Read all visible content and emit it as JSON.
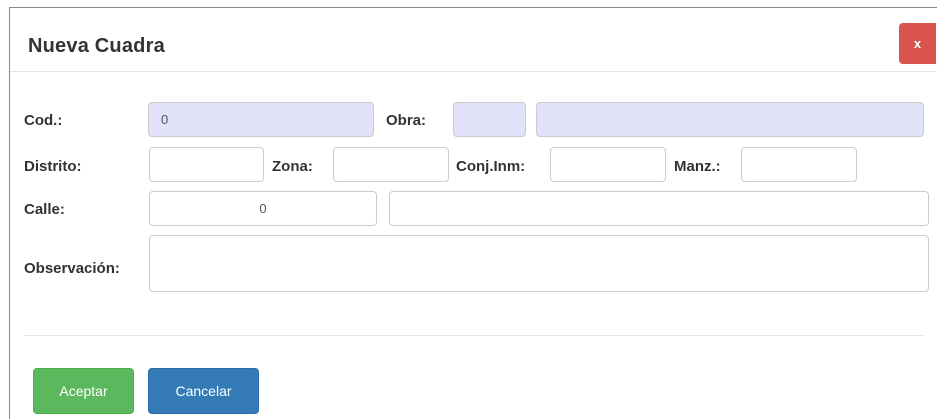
{
  "dialog": {
    "title": "Nueva Cuadra",
    "close_label": "x"
  },
  "form": {
    "cod": {
      "label": "Cod.:",
      "value": "0"
    },
    "obra": {
      "label": "Obra:",
      "code_value": "",
      "name_value": ""
    },
    "distrito": {
      "label": "Distrito:",
      "value": ""
    },
    "zona": {
      "label": "Zona:",
      "value": ""
    },
    "conj_inm": {
      "label": "Conj.Inm:",
      "value": ""
    },
    "manz": {
      "label": "Manz.:",
      "value": ""
    },
    "calle": {
      "label": "Calle:",
      "code_value": "0",
      "name_value": ""
    },
    "observacion": {
      "label": "Observación:",
      "value": ""
    }
  },
  "footer": {
    "accept_label": "Aceptar",
    "cancel_label": "Cancelar"
  },
  "colors": {
    "readonly_bg": "#e1e1f7",
    "accept_green": "#5cb85c",
    "cancel_blue": "#337ab7",
    "close_red": "#d9534f"
  }
}
